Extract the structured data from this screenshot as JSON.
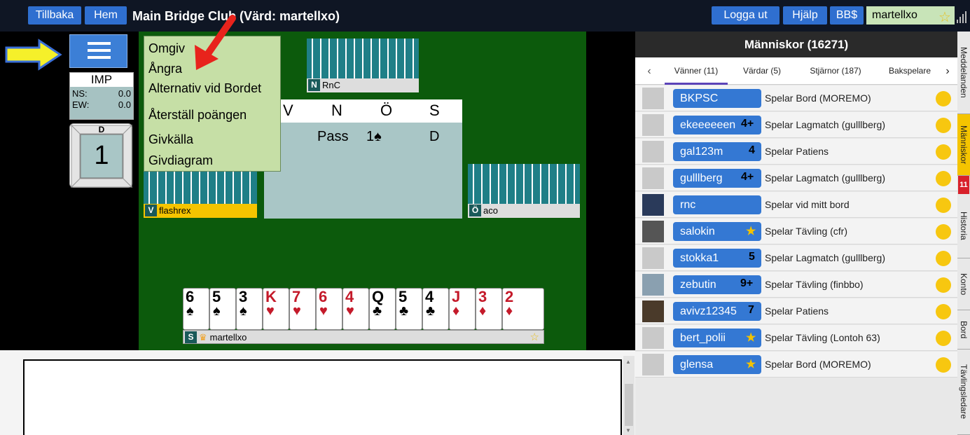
{
  "topbar": {
    "back": "Tillbaka",
    "home": "Hem",
    "title": "Main Bridge Club (Värd: martellxo)",
    "logout": "Logga ut",
    "help": "Hjälp",
    "bbdollars": "BB$",
    "username": "martellxo"
  },
  "score": {
    "type": "IMP",
    "ns_label": "NS:",
    "ns_value": "0.0",
    "ew_label": "EW:",
    "ew_value": "0.0"
  },
  "board": {
    "dealer": "D",
    "number": "1"
  },
  "menu": {
    "items": [
      "Omgiv",
      "Ångra",
      "Alternativ vid Bordet",
      "Återställ poängen",
      "Givkälla",
      "Givdiagram"
    ]
  },
  "players": {
    "north": {
      "seat": "N",
      "name": "RnC"
    },
    "west": {
      "seat": "V",
      "name": "flashrex"
    },
    "east": {
      "seat": "Ö",
      "name": "aco"
    },
    "south": {
      "seat": "S",
      "name": "martellxo"
    }
  },
  "bidding": {
    "headers": [
      "V",
      "N",
      "Ö",
      "S"
    ],
    "bids": [
      "Pass",
      "1♠",
      "D"
    ]
  },
  "hand": [
    {
      "rank": "6",
      "suit": "♠",
      "color": "#000"
    },
    {
      "rank": "5",
      "suit": "♠",
      "color": "#000"
    },
    {
      "rank": "3",
      "suit": "♠",
      "color": "#000"
    },
    {
      "rank": "K",
      "suit": "♥",
      "color": "#c41a2a"
    },
    {
      "rank": "7",
      "suit": "♥",
      "color": "#c41a2a"
    },
    {
      "rank": "6",
      "suit": "♥",
      "color": "#c41a2a"
    },
    {
      "rank": "4",
      "suit": "♥",
      "color": "#c41a2a"
    },
    {
      "rank": "Q",
      "suit": "♣",
      "color": "#000"
    },
    {
      "rank": "5",
      "suit": "♣",
      "color": "#000"
    },
    {
      "rank": "4",
      "suit": "♣",
      "color": "#000"
    },
    {
      "rank": "J",
      "suit": "♦",
      "color": "#c41a2a"
    },
    {
      "rank": "3",
      "suit": "♦",
      "color": "#c41a2a"
    },
    {
      "rank": "2",
      "suit": "♦",
      "color": "#c41a2a"
    }
  ],
  "people": {
    "title": "Människor (16271)",
    "tabs": [
      "Vänner (11)",
      "Värdar (5)",
      "Stjärnor (187)",
      "Bakspelare"
    ],
    "rows": [
      {
        "name": "BKPSC",
        "rank": "",
        "status": "Spelar Bord (MOREMO)"
      },
      {
        "name": "ekeeeeeen",
        "rank": "4+",
        "status": "Spelar Lagmatch (gulllberg)"
      },
      {
        "name": "gal123m",
        "rank": "4",
        "status": "Spelar Patiens"
      },
      {
        "name": "gulllberg",
        "rank": "4+",
        "status": "Spelar Lagmatch (gulllberg)"
      },
      {
        "name": "rnc",
        "rank": "",
        "status": "Spelar vid mitt bord"
      },
      {
        "name": "salokin",
        "rank": "★",
        "status": "Spelar Tävling (cfr)"
      },
      {
        "name": "stokka1",
        "rank": "5",
        "status": "Spelar Lagmatch (gulllberg)"
      },
      {
        "name": "zebutin",
        "rank": "9+",
        "status": "Spelar Tävling (finbbo)"
      },
      {
        "name": "avivz12345",
        "rank": "7",
        "status": "Spelar Patiens"
      },
      {
        "name": "bert_polii",
        "rank": "★",
        "status": "Spelar Tävling (Lontoh 63)"
      },
      {
        "name": "glensa",
        "rank": "★",
        "status": "Spelar Bord (MOREMO)"
      }
    ]
  },
  "sidetabs": [
    "Meddelanden",
    "Människor",
    "Historia",
    "Konto",
    "Bord",
    "Tävlingsledare"
  ],
  "sidetab_badge": "11"
}
